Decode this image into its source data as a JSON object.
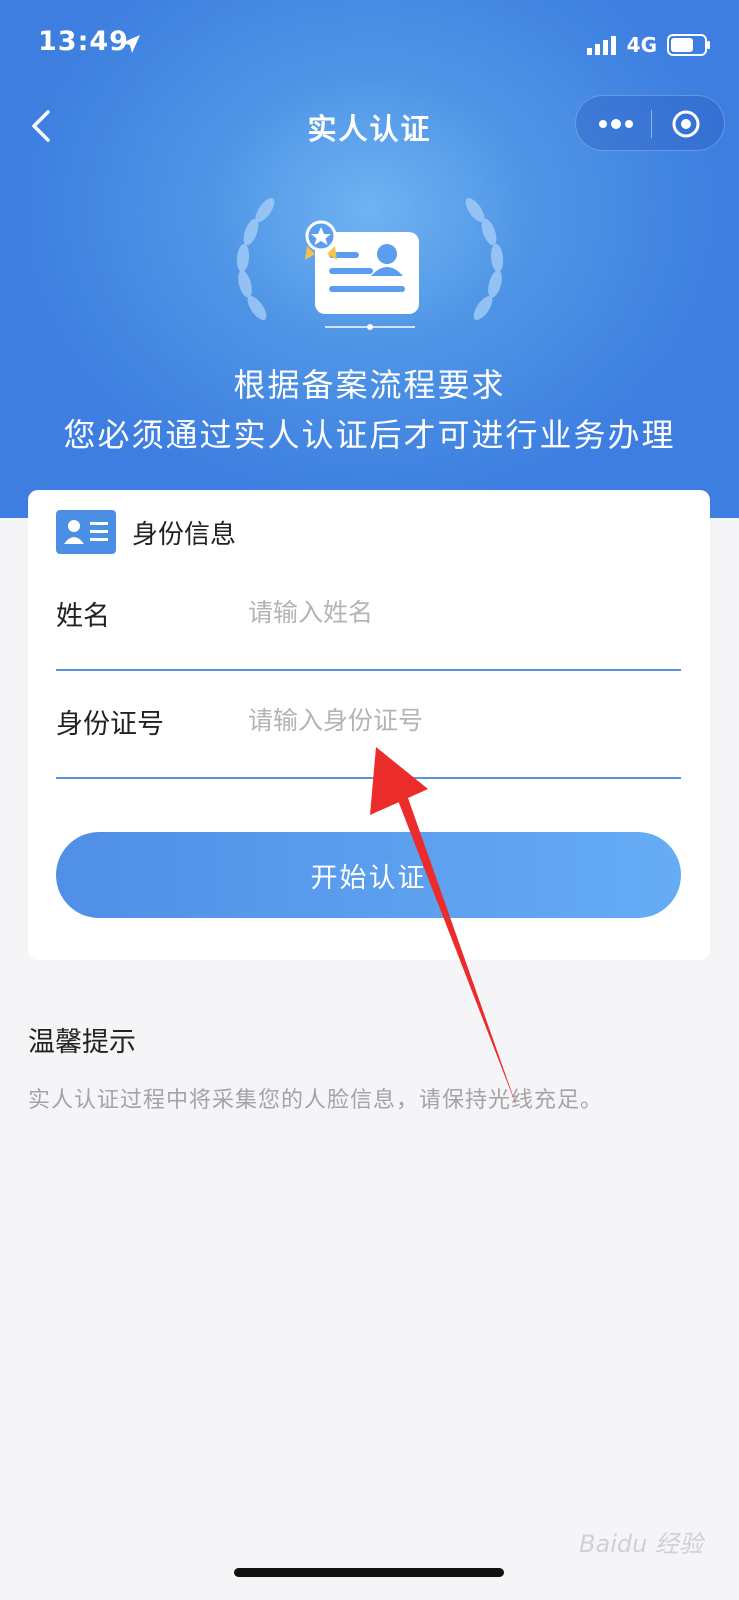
{
  "status_bar": {
    "time": "13:49",
    "network": "4G"
  },
  "nav": {
    "title": "实人认证"
  },
  "hero": {
    "line1": "根据备案流程要求",
    "line2": "您必须通过实人认证后才可进行业务办理"
  },
  "form": {
    "section_title": "身份信息",
    "name": {
      "label": "姓名",
      "value": "",
      "placeholder": "请输入姓名"
    },
    "id_number": {
      "label": "身份证号",
      "value": "",
      "placeholder": "请输入身份证号"
    },
    "submit_label": "开始认证"
  },
  "tips": {
    "title": "温馨提示",
    "body": "实人认证过程中将采集您的人脸信息，请保持光线充足。"
  },
  "watermark": "Baidu 经验",
  "colors": {
    "primary": "#3d7ee0",
    "button_gradient_start": "#4f8fe6",
    "button_gradient_end": "#66acf5",
    "annotation_arrow": "#ec2b2b"
  },
  "icons": [
    "location-arrow-icon",
    "signal-icon",
    "battery-icon",
    "back-chevron-icon",
    "more-dots-icon",
    "miniapp-target-icon",
    "id-card-icon"
  ]
}
